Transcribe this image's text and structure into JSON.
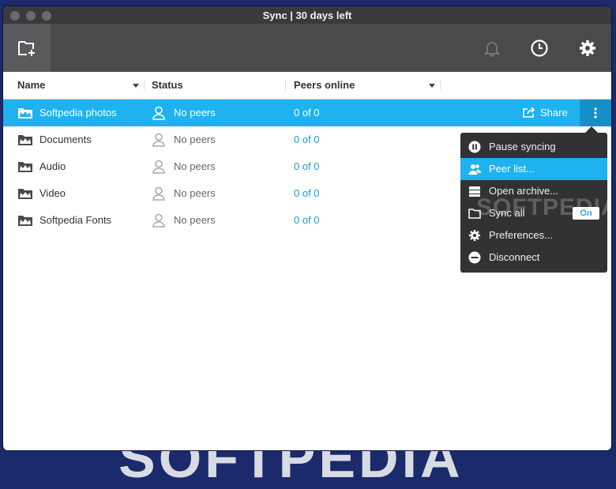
{
  "window": {
    "title": "Sync | 30 days left"
  },
  "toolbar": {
    "add_folder_icon": "add-folder-icon",
    "notifications_icon": "bell-icon",
    "history_icon": "clock-icon",
    "settings_icon": "gear-icon"
  },
  "columns": {
    "name": "Name",
    "status": "Status",
    "peers": "Peers online"
  },
  "rows": [
    {
      "name": "Softpedia photos",
      "status": "No peers",
      "peers": "0 of 0",
      "selected": true
    },
    {
      "name": "Documents",
      "status": "No peers",
      "peers": "0 of 0"
    },
    {
      "name": "Audio",
      "status": "No peers",
      "peers": "0 of 0"
    },
    {
      "name": "Video",
      "status": "No peers",
      "peers": "0 of 0"
    },
    {
      "name": "Softpedia Fonts",
      "status": "No peers",
      "peers": "0 of 0"
    }
  ],
  "share_label": "Share",
  "menu": {
    "items": [
      {
        "label": "Pause syncing",
        "icon": "pause-icon"
      },
      {
        "label": "Peer list...",
        "icon": "users-icon",
        "active": true
      },
      {
        "label": "Open archive...",
        "icon": "archive-icon"
      },
      {
        "label": "Sync all",
        "icon": "folder-icon",
        "toggle": "On"
      },
      {
        "label": "Preferences...",
        "icon": "gear-icon"
      },
      {
        "label": "Disconnect",
        "icon": "minus-circle-icon"
      }
    ]
  },
  "watermarks": {
    "menu": "SOFTPEDIA",
    "background": "SOFTPEDIA"
  },
  "colors": {
    "accent": "#1fb2f0",
    "toolbar": "#4a4a4c",
    "menu_bg": "#323234",
    "link": "#1a9ad6"
  }
}
